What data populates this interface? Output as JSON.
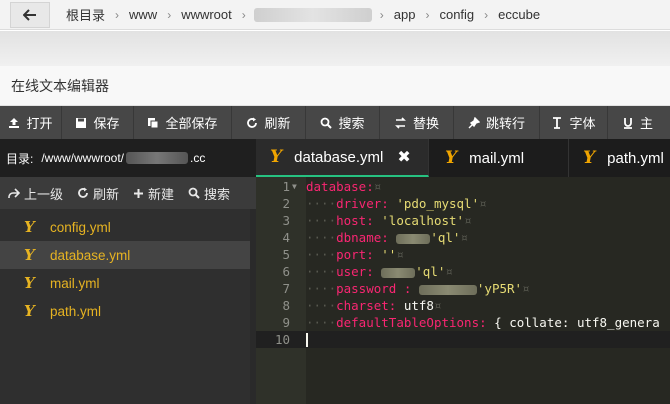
{
  "breadcrumb": {
    "items": [
      "根目录",
      "www",
      "wwwroot",
      "",
      "app",
      "config",
      "eccube"
    ]
  },
  "dialog": {
    "title": "在线文本编辑器"
  },
  "toolbar": {
    "buttons": [
      "打开",
      "保存",
      "全部保存",
      "刷新",
      "搜索",
      "替换",
      "跳转行",
      "字体",
      "主"
    ]
  },
  "sidebar": {
    "path_label": "目录:",
    "path_prefix": "/www/wwwroot/",
    "path_suffix": ".cc",
    "actions": [
      "上一级",
      "刷新",
      "新建",
      "搜索"
    ],
    "files": [
      "config.yml",
      "database.yml",
      "mail.yml",
      "path.yml"
    ],
    "active_file": "database.yml"
  },
  "tabs": {
    "items": [
      "database.yml",
      "mail.yml",
      "path.yml"
    ],
    "active": "database.yml"
  },
  "editor": {
    "lines": [
      {
        "n": "1",
        "key": "database:",
        "indent": "",
        "val": ""
      },
      {
        "n": "2",
        "key": "driver:",
        "indent": "····",
        "val": "'pdo_mysql'"
      },
      {
        "n": "3",
        "key": "host:",
        "indent": "····",
        "val": "'localhost'"
      },
      {
        "n": "4",
        "key": "dbname:",
        "indent": "····",
        "val": "'ql'"
      },
      {
        "n": "5",
        "key": "port:",
        "indent": "····",
        "val": "''"
      },
      {
        "n": "6",
        "key": "user:",
        "indent": "····",
        "val": "'ql'"
      },
      {
        "n": "7",
        "key": "password :",
        "indent": "····",
        "val": "'yP5R'"
      },
      {
        "n": "8",
        "key": "charset:",
        "indent": "····",
        "val": "utf8"
      },
      {
        "n": "9",
        "key": "defaultTableOptions:",
        "indent": "····",
        "val": "{ collate: utf8_genera"
      },
      {
        "n": "10",
        "key": "",
        "indent": "",
        "val": ""
      }
    ],
    "colors": {
      "key": "#f92672",
      "string": "#e6db74",
      "background": "#272822"
    }
  }
}
